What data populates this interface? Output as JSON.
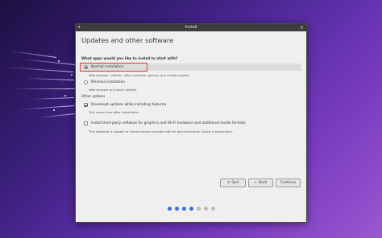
{
  "window": {
    "title": "Install"
  },
  "page": {
    "title": "Updates and other software",
    "question": "What apps would you like to install to start with?"
  },
  "install_options": [
    {
      "label": "Normal installation",
      "description": "Web browser, utilities, office software, games, and media players.",
      "selected": true
    },
    {
      "label": "Minimal installation",
      "description": "Web browser and basic utilities.",
      "selected": false
    }
  ],
  "other_options": {
    "heading": "Other options",
    "items": [
      {
        "label": "Download updates while installing Xubuntu",
        "description": "This saves time after installation.",
        "checked": true
      },
      {
        "label": "Install third-party software for graphics and Wi-Fi hardware and additional media formats",
        "description": "This software is subject to license terms included with its documentation. Some is proprietary.",
        "checked": false
      }
    ]
  },
  "buttons": {
    "quit": "Quit",
    "back": "Back",
    "continue": "Continue"
  },
  "progress": {
    "total_steps": 7,
    "completed_steps": 4
  },
  "colors": {
    "highlight": "#d63a3a",
    "progress_active": "#3b6fd6",
    "progress_inactive": "#bcbcbc"
  }
}
